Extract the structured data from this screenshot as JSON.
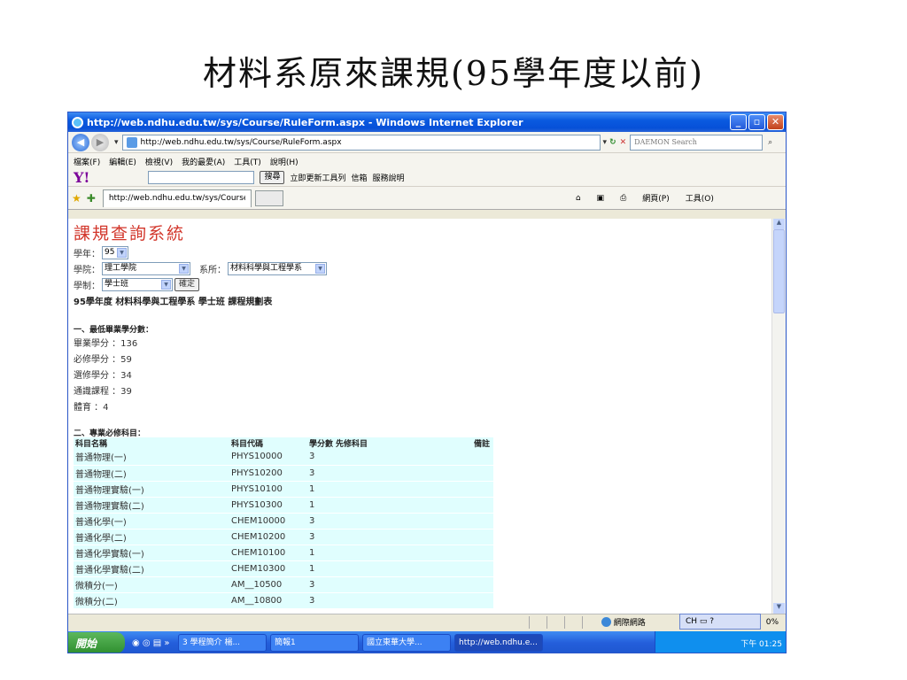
{
  "slide_title": "材料系原來課規(95學年度以前)",
  "window": {
    "title": "http://web.ndhu.edu.tw/sys/Course/RuleForm.aspx - Windows Internet Explorer",
    "address": "http://web.ndhu.edu.tw/sys/Course/RuleForm.aspx",
    "search_placeholder": "DAEMON Search"
  },
  "menu": [
    "檔案(F)",
    "編輯(E)",
    "檢視(V)",
    "我的最愛(A)",
    "工具(T)",
    "說明(H)"
  ],
  "yahoo_bar": {
    "search_btn": "搜尋",
    "update": "立即更新工具列",
    "mail": "信箱",
    "service": "服務說明"
  },
  "tab": {
    "label": "http://web.ndhu.edu.tw/sys/Course/RuleForm.aspx",
    "page_menu": "網頁(P)",
    "tools_menu": "工具(O)"
  },
  "page": {
    "header": "課規查詢系統",
    "year_label": "學年：",
    "year_value": "95",
    "college_label": "學院：",
    "college_value": "理工學院",
    "dept_label": "系所：",
    "dept_value": "材料科學與工程學系",
    "system_label": "學制：",
    "system_value": "學士班",
    "confirm": "確定",
    "report_title": "95學年度 材料科學與工程學系 學士班 課程規劃表",
    "section1": "一、最低畢業學分數：",
    "stats": [
      "畢業學分 ：136",
      "必修學分 ：59",
      "選修學分 ：34",
      "通識課程 ：39",
      "體育 ：4"
    ],
    "section2": "二、專業必修科目：",
    "columns": [
      "科目名稱",
      "科目代碼",
      "學分數",
      "先修科目",
      "備註"
    ],
    "rows": [
      [
        "普通物理(一)",
        "PHYS10000",
        "3"
      ],
      [
        "普通物理(二)",
        "PHYS10200",
        "3"
      ],
      [
        "普通物理實驗(一)",
        "PHYS10100",
        "1"
      ],
      [
        "普通物理實驗(二)",
        "PHYS10300",
        "1"
      ],
      [
        "普通化學(一)",
        "CHEM10000",
        "3"
      ],
      [
        "普通化學(二)",
        "CHEM10200",
        "3"
      ],
      [
        "普通化學實驗(一)",
        "CHEM10100",
        "1"
      ],
      [
        "普通化學實驗(二)",
        "CHEM10300",
        "1"
      ],
      [
        "微積分(一)",
        "AM__10500",
        "3"
      ],
      [
        "微積分(二)",
        "AM__10800",
        "3"
      ]
    ]
  },
  "status": {
    "zone": "網際網路",
    "zoom": "0%",
    "lang": "CH"
  },
  "taskbar": {
    "start": "開始",
    "tasks": [
      "3 學程簡介 楊...",
      "簡報1",
      "國立東華大學...",
      "http://web.ndhu.e..."
    ],
    "clock": "下午 01:25"
  }
}
